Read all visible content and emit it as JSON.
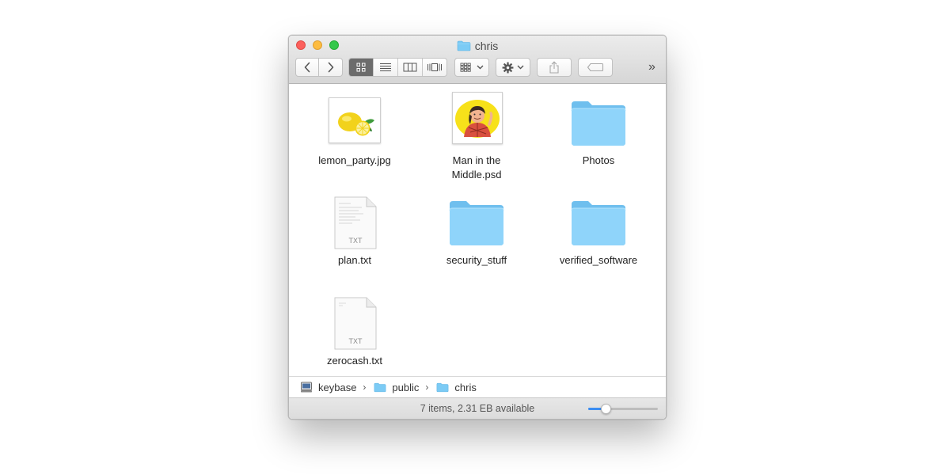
{
  "window": {
    "title": "chris",
    "title_icon": "folder-icon"
  },
  "toolbar": {
    "back_icon": "chevron-left-icon",
    "forward_icon": "chevron-right-icon",
    "views": [
      "icon-view",
      "list-view",
      "column-view",
      "cover-flow-view"
    ],
    "active_view": "icon-view",
    "arrange_icon": "arrange-grid-icon",
    "action_icon": "gear-icon",
    "share_icon": "share-icon",
    "tag_icon": "tag-icon",
    "more": "»"
  },
  "files": [
    {
      "name": "lemon_party.jpg",
      "kind": "image"
    },
    {
      "name": "Man in the Middle.psd",
      "kind": "image"
    },
    {
      "name": "Photos",
      "kind": "folder"
    },
    {
      "name": "plan.txt",
      "kind": "text",
      "badge": "TXT"
    },
    {
      "name": "security_stuff",
      "kind": "folder"
    },
    {
      "name": "verified_software",
      "kind": "folder"
    },
    {
      "name": "zerocash.txt",
      "kind": "text",
      "badge": "TXT"
    }
  ],
  "pathbar": {
    "segments": [
      {
        "label": "keybase",
        "icon": "drive-icon"
      },
      {
        "label": "public",
        "icon": "folder-icon"
      },
      {
        "label": "chris",
        "icon": "folder-icon"
      }
    ]
  },
  "status": {
    "text": "7 items, 2.31 EB available",
    "zoom_level": 0.25
  },
  "colors": {
    "folder": "#7ccbf5",
    "accent": "#3b8df2"
  }
}
